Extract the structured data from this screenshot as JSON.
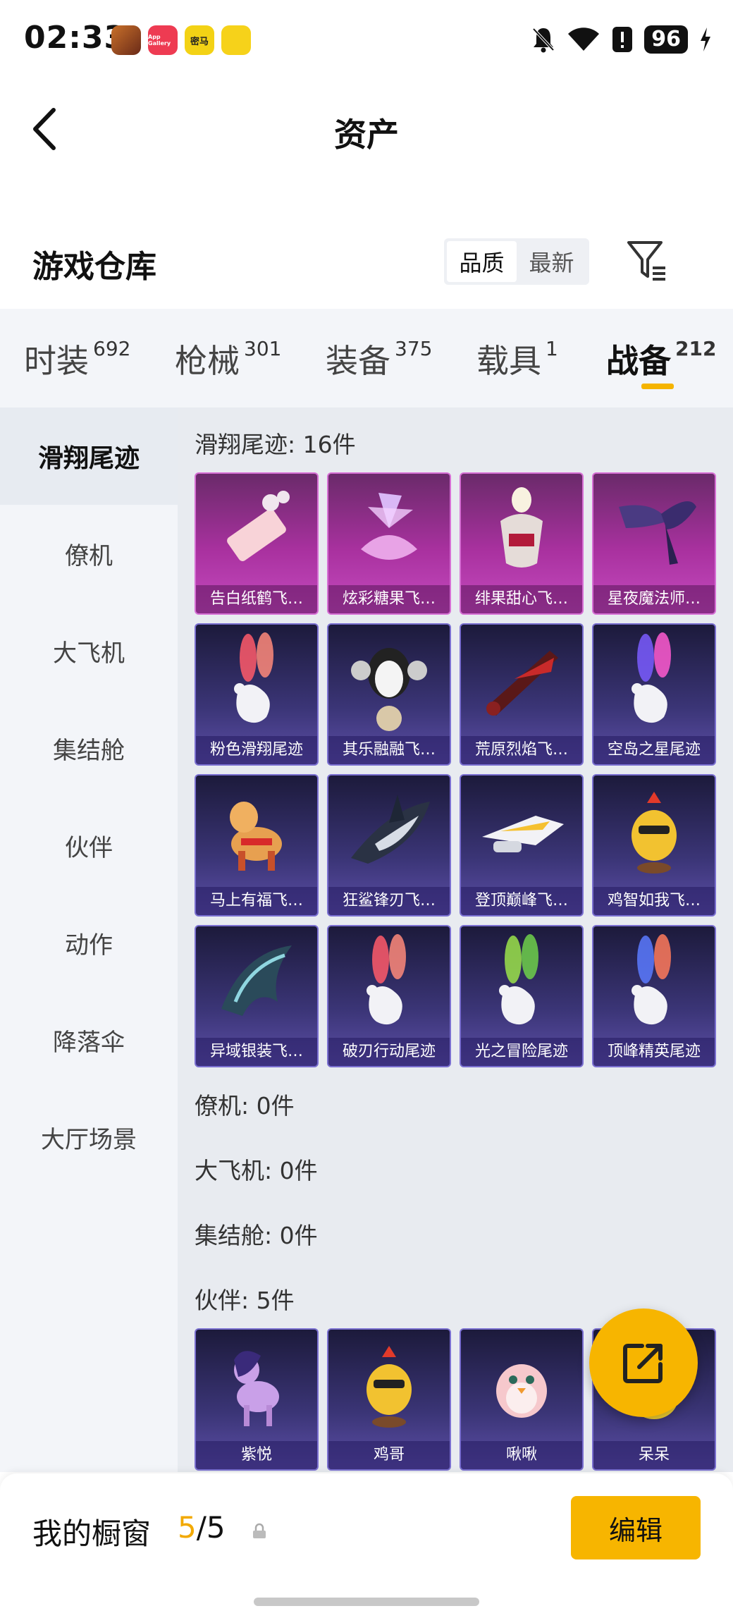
{
  "status_bar": {
    "time": "02:33",
    "battery": "96",
    "app_icons": [
      "game-app-icon",
      "appgallery-icon",
      "mima-app-icon",
      "yellow-app-icon"
    ],
    "app_icon_text": [
      "",
      "App Gallery",
      "密马",
      ""
    ]
  },
  "nav": {
    "title": "资产"
  },
  "warehouse": {
    "title": "游戏仓库",
    "sort_options": [
      "品质",
      "最新"
    ],
    "active_sort": "品质"
  },
  "tabs": [
    {
      "label": "时装",
      "count": "692"
    },
    {
      "label": "枪械",
      "count": "301"
    },
    {
      "label": "装备",
      "count": "375"
    },
    {
      "label": "载具",
      "count": "1"
    },
    {
      "label": "战备",
      "count": "212"
    }
  ],
  "active_tab": "战备",
  "sidebar": {
    "items": [
      "滑翔尾迹",
      "僚机",
      "大飞机",
      "集结舱",
      "伙伴",
      "动作",
      "降落伞",
      "大厅场景"
    ],
    "active": "滑翔尾迹"
  },
  "sections": {
    "glide": {
      "label": "滑翔尾迹: 16件",
      "items": [
        {
          "name": "告白纸鹤飞…",
          "quality": "purple",
          "icon": "paper-crane-icon"
        },
        {
          "name": "炫彩糖果飞…",
          "quality": "purple",
          "icon": "candy-icon"
        },
        {
          "name": "绯果甜心飞…",
          "quality": "purple",
          "icon": "sweetheart-icon"
        },
        {
          "name": "星夜魔法师…",
          "quality": "purple",
          "icon": "wings-icon"
        },
        {
          "name": "粉色滑翔尾迹",
          "quality": "blue",
          "icon": "smoke-trail-icon"
        },
        {
          "name": "其乐融融飞…",
          "quality": "blue",
          "icon": "penguin-icon"
        },
        {
          "name": "荒原烈焰飞…",
          "quality": "blue",
          "icon": "flame-glider-icon"
        },
        {
          "name": "空岛之星尾迹",
          "quality": "blue",
          "icon": "rainbow-trail-icon"
        },
        {
          "name": "马上有福飞…",
          "quality": "blue",
          "icon": "horse-icon"
        },
        {
          "name": "狂鲨锋刃飞…",
          "quality": "blue",
          "icon": "shark-icon"
        },
        {
          "name": "登顶巅峰飞…",
          "quality": "blue",
          "icon": "jet-icon"
        },
        {
          "name": "鸡智如我飞…",
          "quality": "blue",
          "icon": "chicken-icon"
        },
        {
          "name": "异域银装飞…",
          "quality": "blue",
          "icon": "exotic-wing-icon"
        },
        {
          "name": "破刃行动尾迹",
          "quality": "blue",
          "icon": "smoke-trail-icon"
        },
        {
          "name": "光之冒险尾迹",
          "quality": "blue",
          "icon": "green-trail-icon"
        },
        {
          "name": "顶峰精英尾迹",
          "quality": "blue",
          "icon": "elite-trail-icon"
        }
      ]
    },
    "wingman": {
      "label": "僚机: 0件"
    },
    "big_plane": {
      "label": "大飞机: 0件"
    },
    "assembly_pod": {
      "label": "集结舱: 0件"
    },
    "partner": {
      "label": "伙伴: 5件",
      "items": [
        {
          "name": "紫悦",
          "quality": "blue",
          "icon": "pony-icon"
        },
        {
          "name": "鸡哥",
          "quality": "blue",
          "icon": "chicken-icon"
        },
        {
          "name": "啾啾",
          "quality": "blue",
          "icon": "bird-icon"
        },
        {
          "name": "呆呆",
          "quality": "blue",
          "icon": "duck-icon"
        }
      ]
    }
  },
  "bottom_bar": {
    "showcase_label": "我的橱窗",
    "showcase_current": "5",
    "showcase_separator": "/",
    "showcase_total": "5",
    "edit_label": "编辑"
  },
  "colors": {
    "accent": "#f7b500",
    "purple_quality": "#a9319f",
    "blue_quality": "#3b3577"
  }
}
